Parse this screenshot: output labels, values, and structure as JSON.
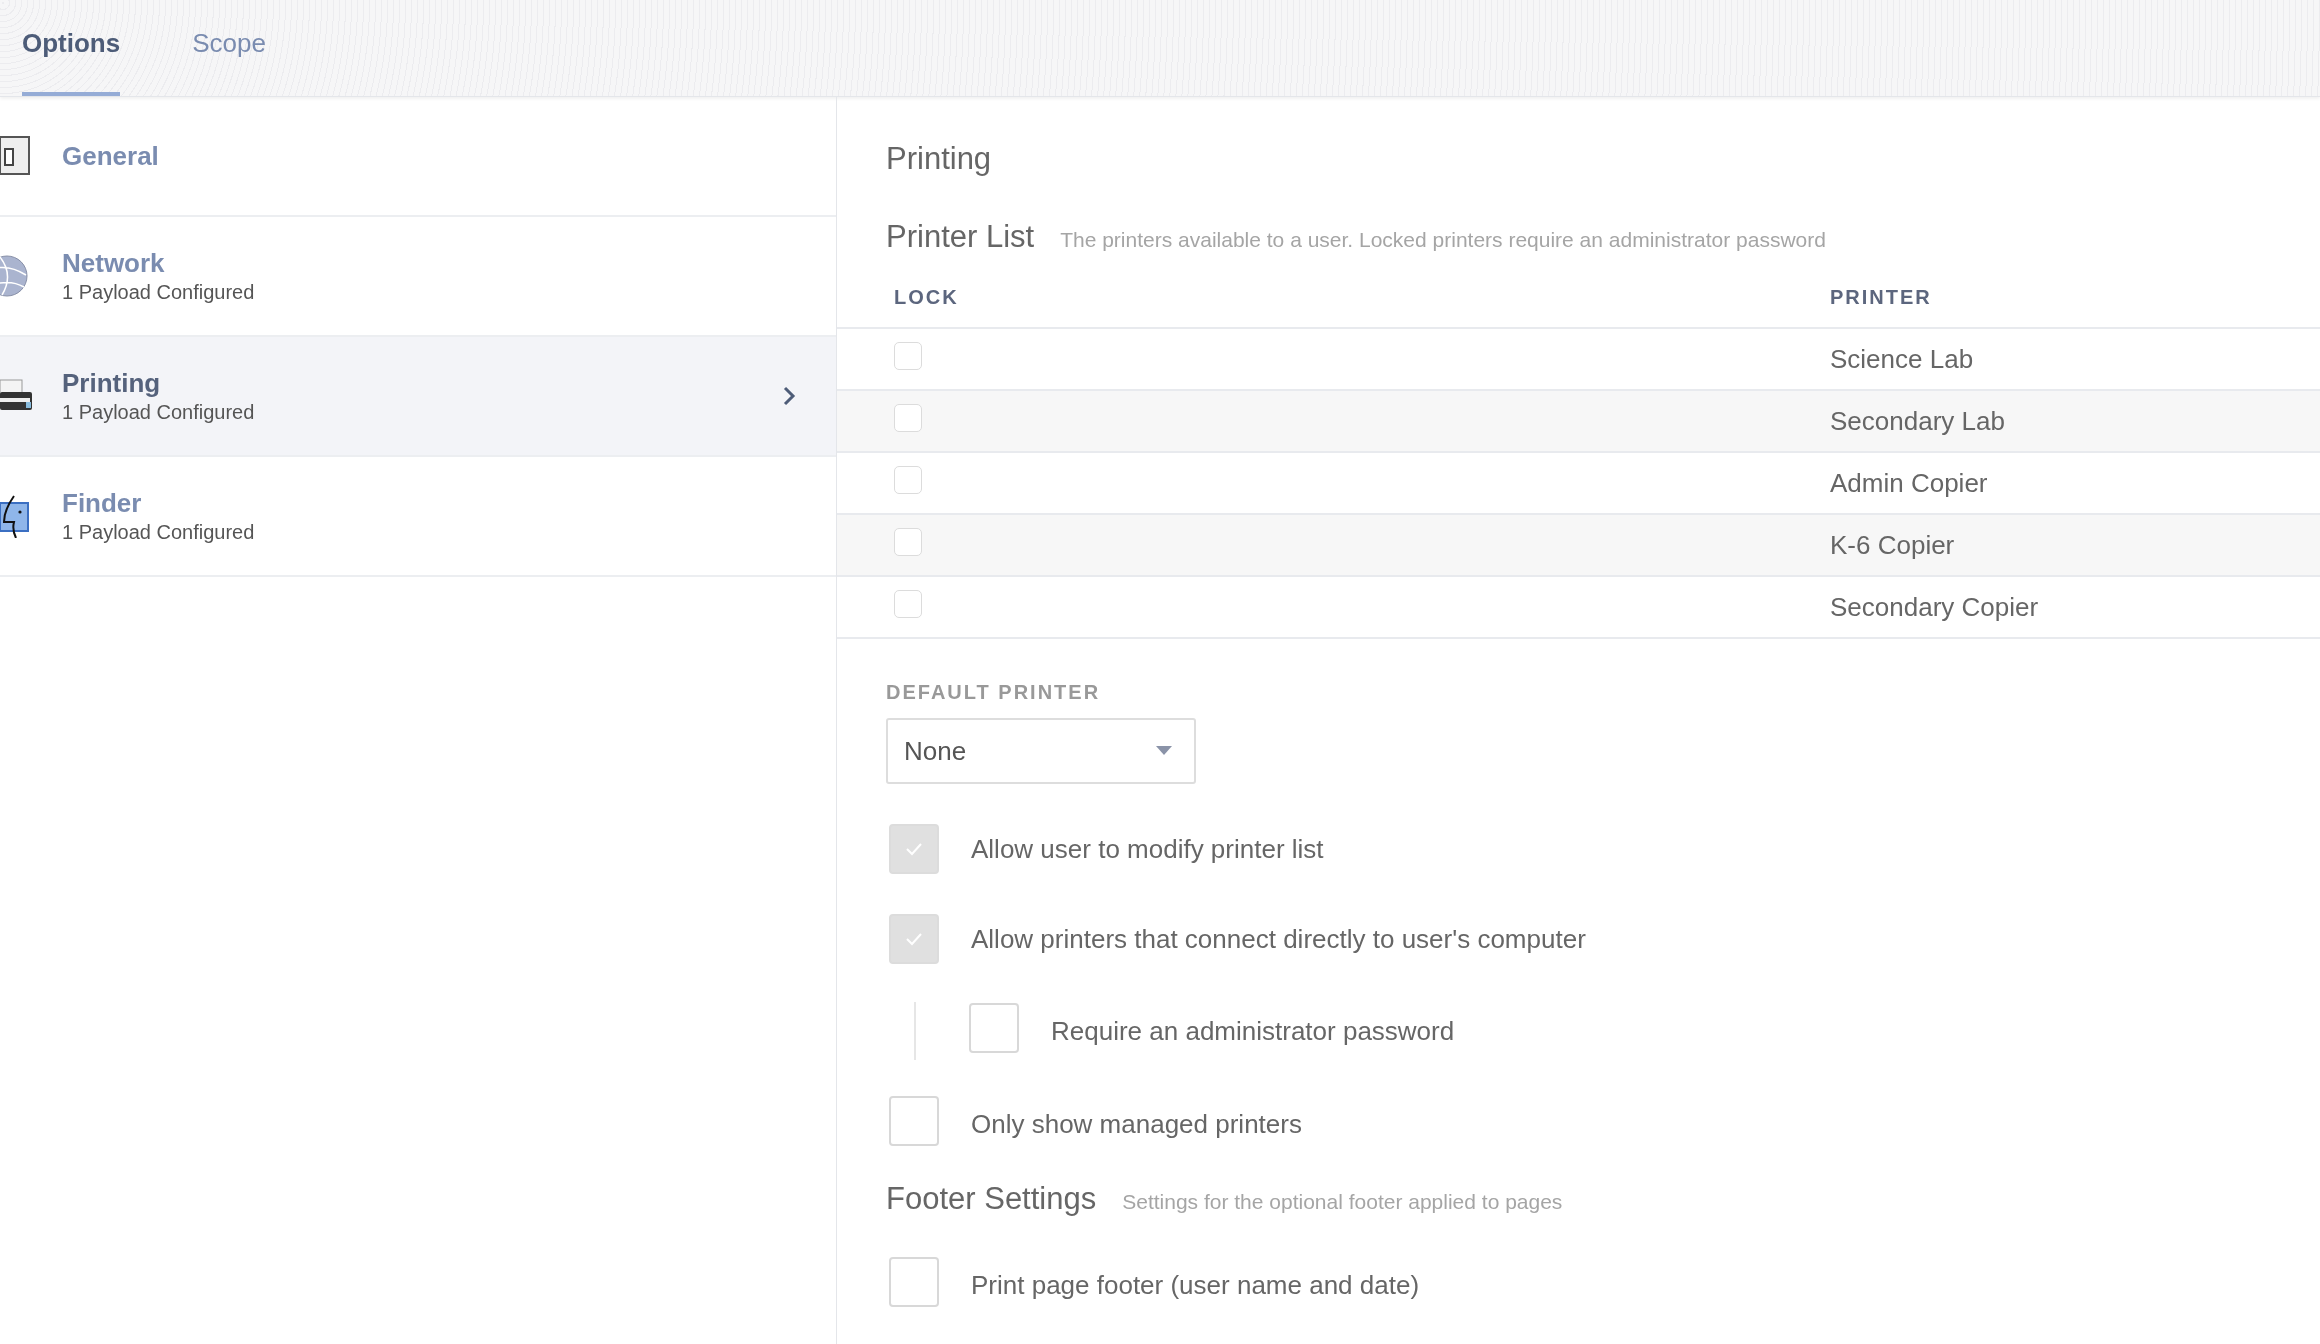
{
  "tabs": [
    {
      "label": "Options",
      "selected": true
    },
    {
      "label": "Scope",
      "selected": false
    }
  ],
  "sidebar": {
    "items": [
      {
        "kind": "switch",
        "title": "General",
        "selected": false
      },
      {
        "kind": "globe",
        "title": "Network",
        "subtitle": "1 Payload Configured",
        "selected": false
      },
      {
        "kind": "printer",
        "title": "Printing",
        "subtitle": "1 Payload Configured",
        "selected": true
      },
      {
        "kind": "finder",
        "title": "Finder",
        "subtitle": "1 Payload Configured",
        "selected": false
      }
    ]
  },
  "panel": {
    "title": "Printing",
    "printer_list": {
      "title": "Printer List",
      "description": "The printers available to a user. Locked printers require an administrator password",
      "columns": [
        "LOCK",
        "PRINTER"
      ],
      "rows": [
        {
          "locked": false,
          "printer": "Science Lab"
        },
        {
          "locked": false,
          "printer": "Secondary Lab"
        },
        {
          "locked": false,
          "printer": "Admin Copier"
        },
        {
          "locked": false,
          "printer": "K-6 Copier"
        },
        {
          "locked": false,
          "printer": "Secondary Copier"
        }
      ]
    },
    "default_printer": {
      "label": "DEFAULT PRINTER",
      "value": "None"
    },
    "options": [
      {
        "label": "Allow user to modify printer list",
        "checked": true,
        "disabled": true
      },
      {
        "label": "Allow printers that connect directly to user's computer",
        "checked": true,
        "disabled": true,
        "children": [
          {
            "label": "Require an administrator password",
            "checked": false,
            "disabled": false
          }
        ]
      },
      {
        "label": "Only show managed printers",
        "checked": false,
        "disabled": false
      }
    ],
    "footer": {
      "title": "Footer Settings",
      "description": "Settings for the optional footer applied to pages",
      "options": [
        {
          "label": "Print page footer (user name and date)",
          "checked": false,
          "disabled": false
        }
      ]
    }
  }
}
